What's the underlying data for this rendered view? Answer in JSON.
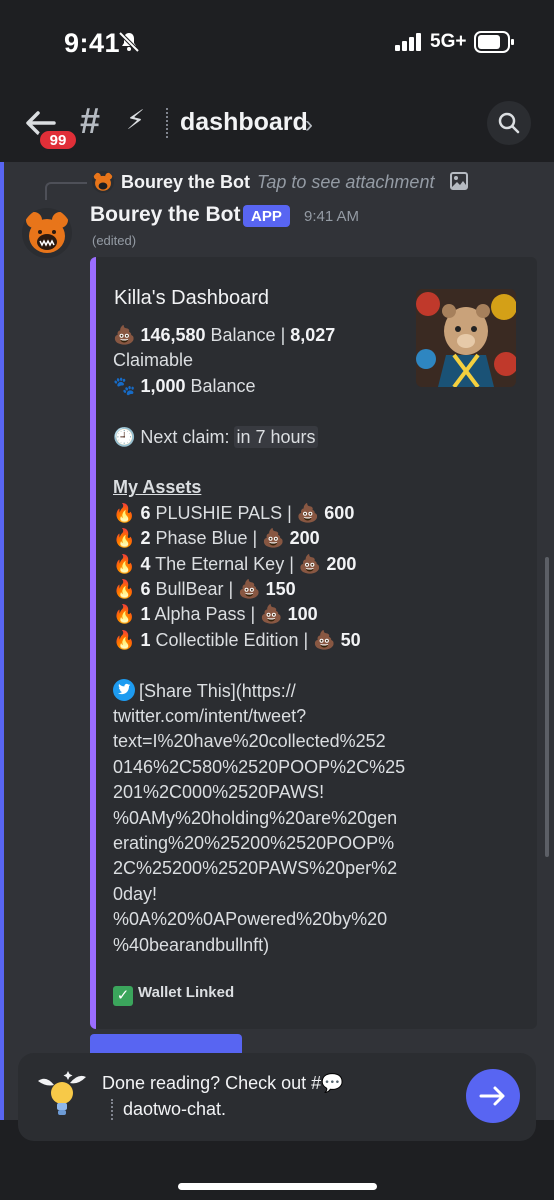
{
  "status_bar": {
    "time": "9:41",
    "network": "5G+"
  },
  "header": {
    "badge_count": "99",
    "hash": "#",
    "channel_emoji": "⚡",
    "channel_name": "dashboard",
    "chevron": "›"
  },
  "reply": {
    "author": "Bourey the Bot",
    "text": "Tap to see attachment"
  },
  "message": {
    "author": "Bourey the Bot",
    "tag": "APP",
    "time": "9:41 AM",
    "edited": "(edited)"
  },
  "embed": {
    "title": "Killa's Dashboard",
    "poop_emoji": "💩",
    "paw_emoji": "🐾",
    "clock_emoji": "🕘",
    "fire_emoji": "🔥",
    "balance_amount": "146,580",
    "balance_label": " Balance | ",
    "claimable_amount": "8,027",
    "claimable_label": "Claimable",
    "paws_amount": "1,000",
    "paws_label": " Balance",
    "next_claim_label": " Next claim: ",
    "next_claim_value": "in 7 hours",
    "assets_heading": "My Assets",
    "assets": [
      {
        "count": "6",
        "name": " PLUSHIE PALS | ",
        "value": "600"
      },
      {
        "count": "2",
        "name": " Phase Blue | ",
        "value": "200"
      },
      {
        "count": "4",
        "name": " The Eternal Key | ",
        "value": "200"
      },
      {
        "count": "6",
        "name": " BullBear | ",
        "value": "150"
      },
      {
        "count": "1",
        "name": " Alpha Pass | ",
        "value": "100"
      },
      {
        "count": "1",
        "name": " Collectible Edition | ",
        "value": "50"
      }
    ],
    "share_lines": [
      "[Share This](https://",
      "twitter.com/intent/tweet?",
      "text=I%20have%20collected%252",
      "0146%2C580%2520POOP%2C%25",
      "201%2C000%2520PAWS!",
      "%0AMy%20holding%20are%20gen",
      "erating%20%25200%2520POOP%",
      "2C%25200%2520PAWS%20per%2",
      "0day!",
      "%0A%20%0APowered%20by%20",
      "%40bearandbullnft)"
    ],
    "footer": "Wallet Linked"
  },
  "prompt": {
    "line1": "Done reading? Check out #💬",
    "line2": "daotwo-chat."
  }
}
